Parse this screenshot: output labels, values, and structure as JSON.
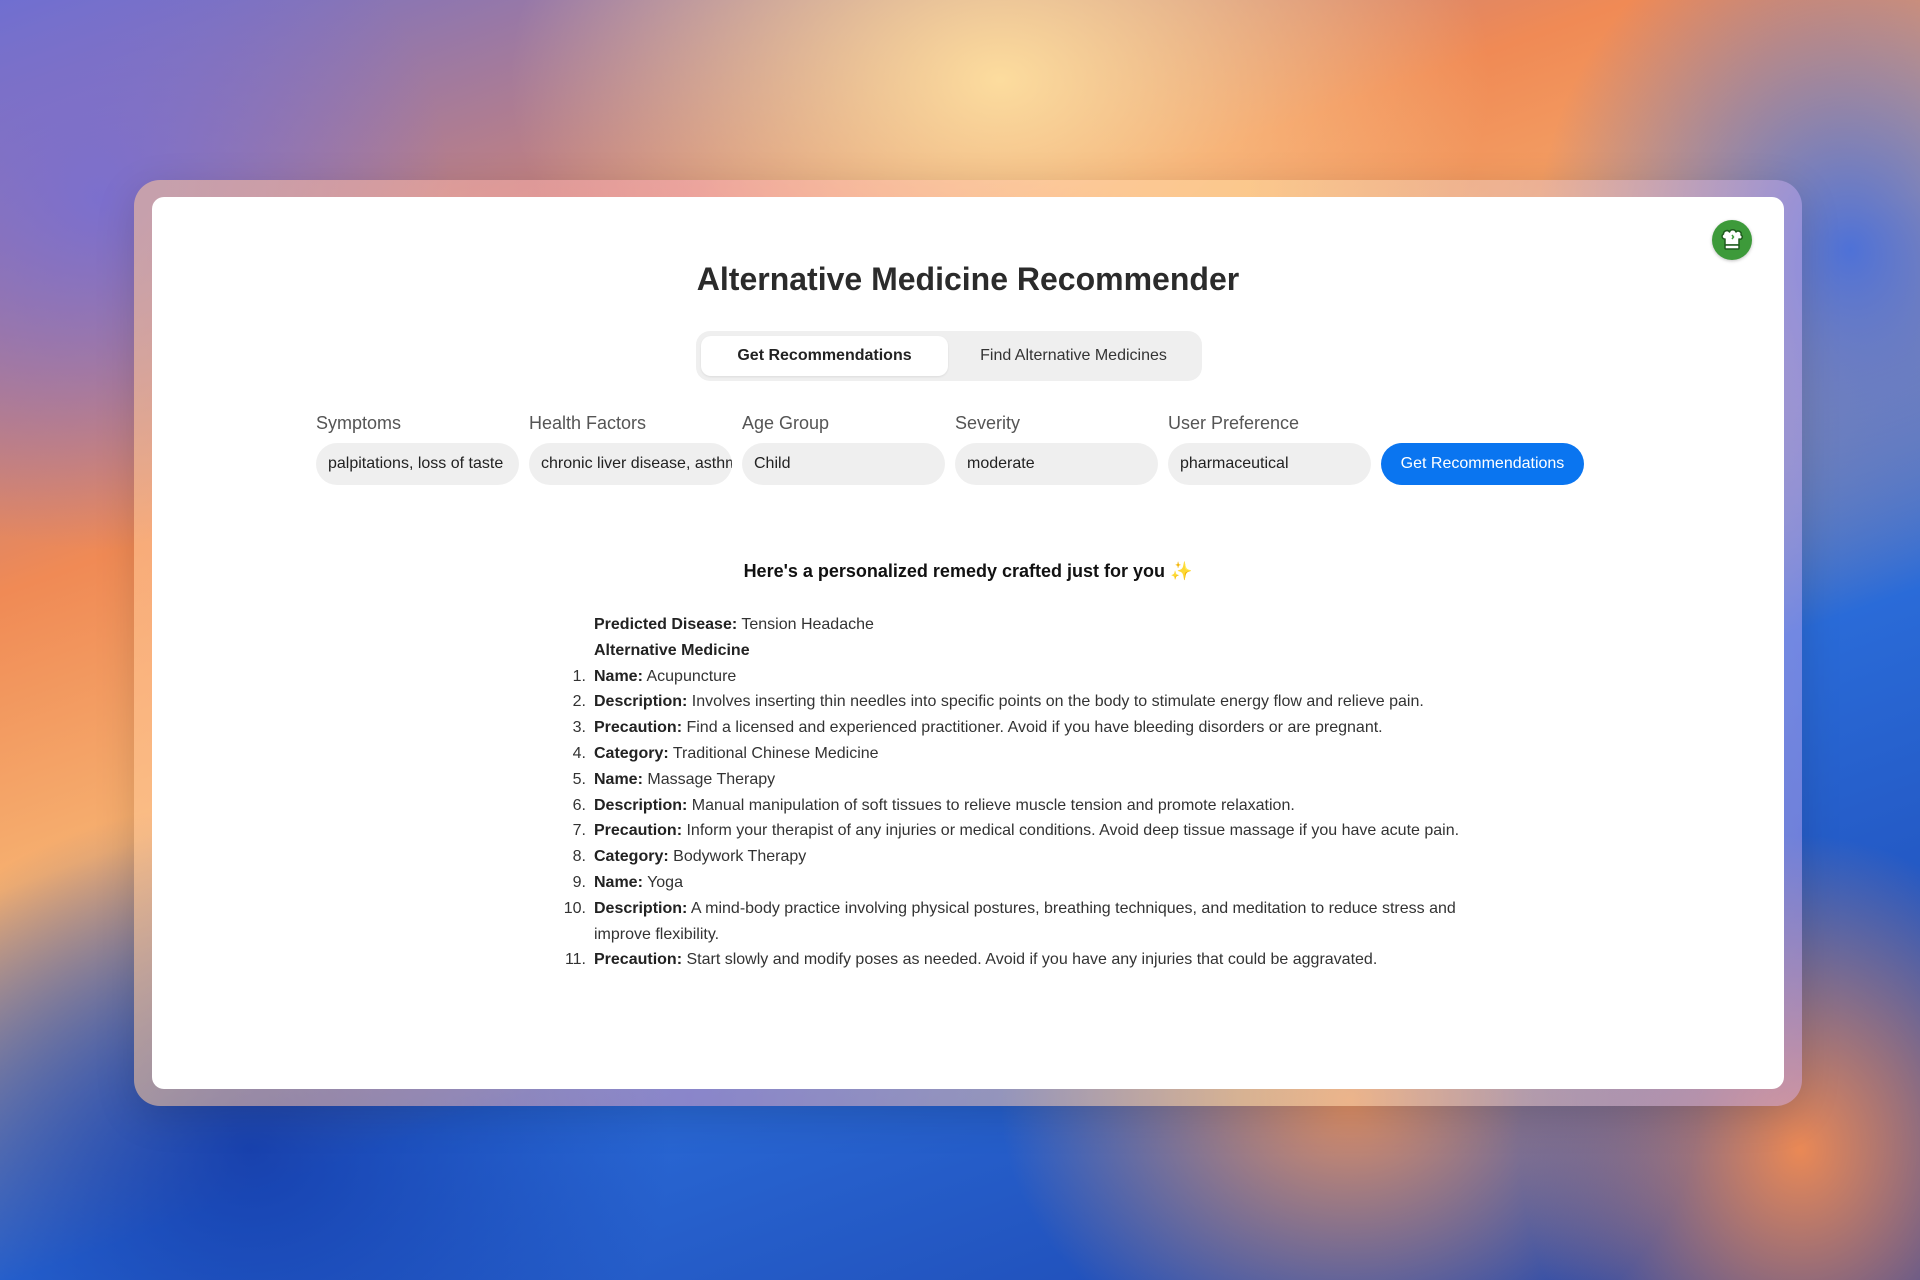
{
  "app": {
    "title": "Alternative Medicine Recommender"
  },
  "tabs": [
    {
      "label": "Get Recommendations",
      "active": true
    },
    {
      "label": "Find Alternative Medicines",
      "active": false
    }
  ],
  "form": {
    "symptoms": {
      "label": "Symptoms",
      "value": "palpitations, loss of taste"
    },
    "health_factors": {
      "label": "Health Factors",
      "value": "chronic liver disease, asthma"
    },
    "age_group": {
      "label": "Age Group",
      "value": "Child"
    },
    "severity": {
      "label": "Severity",
      "value": "moderate"
    },
    "user_preference": {
      "label": "User Preference",
      "value": "pharmaceutical"
    },
    "submit_label": "Get Recommendations"
  },
  "result": {
    "heading": "Here's a personalized remedy crafted just for you",
    "heading_emoji": "✨",
    "predicted_label": "Predicted Disease:",
    "predicted_value": "Tension Headache",
    "section_title": "Alternative Medicine",
    "items": [
      {
        "key": "Name:",
        "text": "Acupuncture"
      },
      {
        "key": "Description:",
        "text": "Involves inserting thin needles into specific points on the body to stimulate energy flow and relieve pain."
      },
      {
        "key": "Precaution:",
        "text": "Find a licensed and experienced practitioner. Avoid if you have bleeding disorders or are pregnant."
      },
      {
        "key": "Category:",
        "text": "Traditional Chinese Medicine"
      },
      {
        "key": "Name:",
        "text": "Massage Therapy"
      },
      {
        "key": "Description:",
        "text": "Manual manipulation of soft tissues to relieve muscle tension and promote relaxation."
      },
      {
        "key": "Precaution:",
        "text": "Inform your therapist of any injuries or medical conditions. Avoid deep tissue massage if you have acute pain."
      },
      {
        "key": "Category:",
        "text": "Bodywork Therapy"
      },
      {
        "key": "Name:",
        "text": "Yoga"
      },
      {
        "key": "Description:",
        "text": "A mind-body practice involving physical postures, breathing techniques, and meditation to reduce stress and improve flexibility."
      },
      {
        "key": "Precaution:",
        "text": "Start slowly and modify poses as needed. Avoid if you have any injuries that could be aggravated."
      }
    ]
  },
  "icons": {
    "avatar": "chef-hat-icon"
  },
  "colors": {
    "primary_button": "#0a75f0",
    "avatar_bg": "#3d9a3a"
  }
}
